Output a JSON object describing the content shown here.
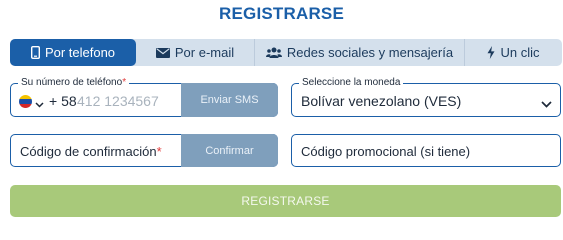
{
  "title": "REGISTRARSE",
  "tabs": [
    {
      "label": "Por telefono",
      "icon": "phone-icon",
      "active": true
    },
    {
      "label": "Por e-mail",
      "icon": "envelope-icon",
      "active": false
    },
    {
      "label": "Redes sociales y mensajería",
      "icon": "users-icon",
      "active": false
    },
    {
      "label": "Un clic",
      "icon": "lightning-icon",
      "active": false
    }
  ],
  "phone": {
    "label": "Su número de teléfono",
    "required_mark": "*",
    "country_flag": "venezuela-flag-icon",
    "prefix": "+ 58",
    "placeholder": "412 1234567",
    "send_sms_label": "Enviar SMS"
  },
  "currency": {
    "label": "Seleccione la moneda",
    "value": "Bolívar venezolano (VES)"
  },
  "confirmation": {
    "placeholder": "Código de confirmación",
    "required_mark": "*",
    "confirm_label": "Confirmar"
  },
  "promo": {
    "placeholder": "Código promocional (si tiene)"
  },
  "submit_label": "REGISTRARSE",
  "colors": {
    "primary": "#1b5fa8",
    "tab_bar": "#d4e0ec",
    "disabled_button": "#7f9fbc",
    "register_button": "#a8c97a",
    "required": "#e03a3a"
  }
}
